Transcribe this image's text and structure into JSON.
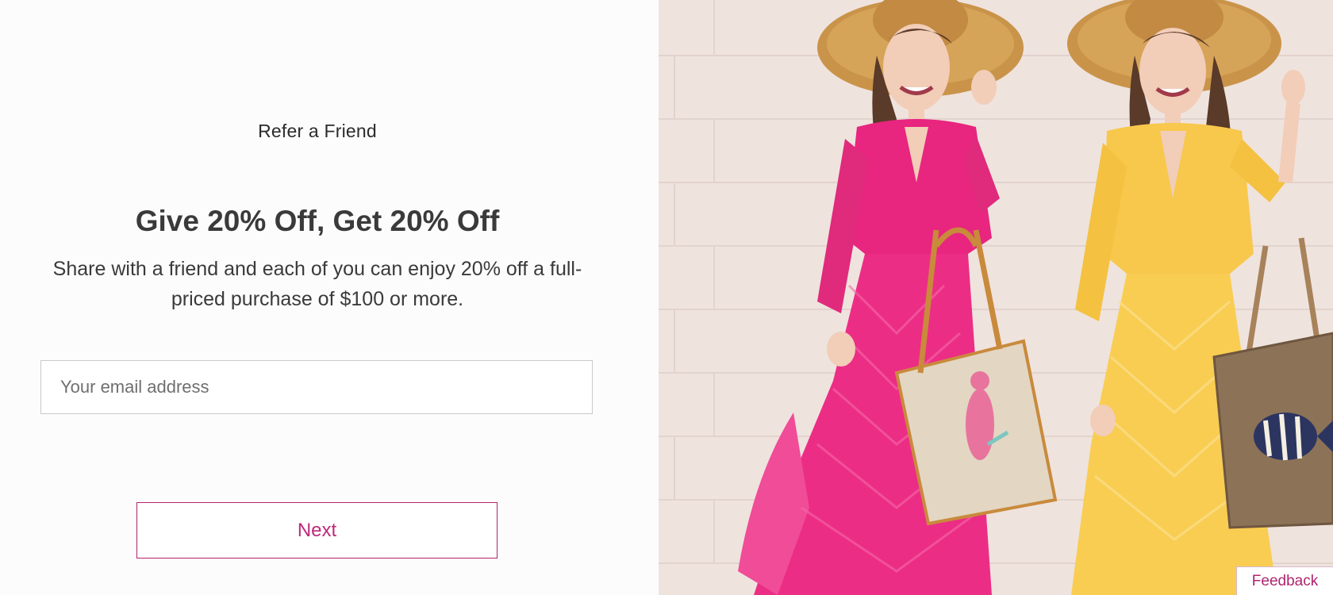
{
  "modal": {
    "eyebrow": "Refer a Friend",
    "headline": "Give 20% Off, Get 20% Off",
    "subtext": "Share with a friend and each of you can enjoy 20% off a full-priced purchase of $100 or more.",
    "email_placeholder": "Your email address",
    "email_value": "",
    "next_label": "Next"
  },
  "hero_image": {
    "description_icon": "promo-photo"
  },
  "feedback": {
    "label": "Feedback"
  },
  "colors": {
    "accent": "#c0287a",
    "background": "#fdfcfc",
    "text": "#3a3a3a"
  }
}
